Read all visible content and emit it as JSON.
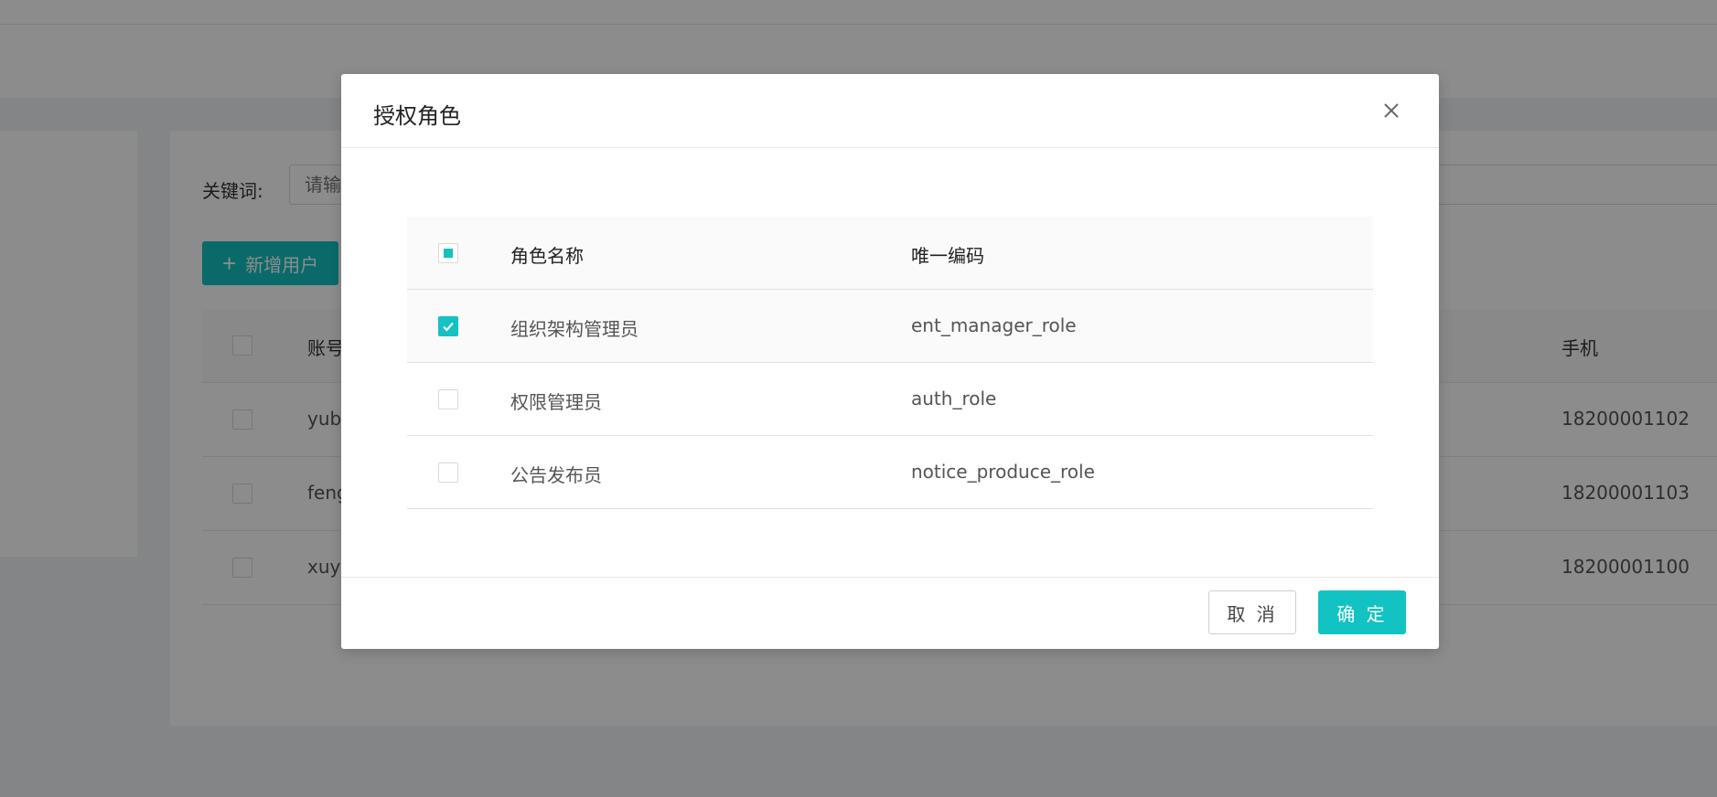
{
  "background": {
    "search": {
      "label": "关键词:",
      "placeholder": "请输入"
    },
    "add_user_button": "新增用户",
    "table": {
      "headers": {
        "account": "账号",
        "phone": "手机"
      },
      "rows": [
        {
          "account": "yuba",
          "phone": "18200001102"
        },
        {
          "account": "feng",
          "phone": "18200001103"
        },
        {
          "account": "xuyu",
          "phone": "18200001100"
        }
      ]
    }
  },
  "modal": {
    "title": "授权角色",
    "table": {
      "headers": {
        "name": "角色名称",
        "code": "唯一编码"
      },
      "header_checkbox_state": "indeterminate",
      "rows": [
        {
          "name": "组织架构管理员",
          "code": "ent_manager_role",
          "checked": true
        },
        {
          "name": "权限管理员",
          "code": "auth_role",
          "checked": false
        },
        {
          "name": "公告发布员",
          "code": "notice_produce_role",
          "checked": false
        }
      ]
    },
    "footer": {
      "cancel": "取 消",
      "ok": "确 定"
    }
  },
  "colors": {
    "primary": "#13c2c2",
    "mask": "rgba(0,0,0,0.45)"
  },
  "icons": {
    "close": "close-icon",
    "add": "plus-icon",
    "check": "check-icon"
  }
}
